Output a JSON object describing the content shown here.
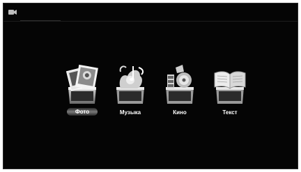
{
  "header": {
    "indicator_icon": "camera-icon"
  },
  "menu": {
    "selected_index": 0,
    "items": [
      {
        "label": "Фото",
        "icon": "photos-icon"
      },
      {
        "label": "Музыка",
        "icon": "music-icon"
      },
      {
        "label": "Кино",
        "icon": "film-icon"
      },
      {
        "label": "Текст",
        "icon": "book-icon"
      }
    ]
  },
  "colors": {
    "background": "#050505",
    "label": "#ffffff",
    "highlight": "#7a7a7a"
  }
}
